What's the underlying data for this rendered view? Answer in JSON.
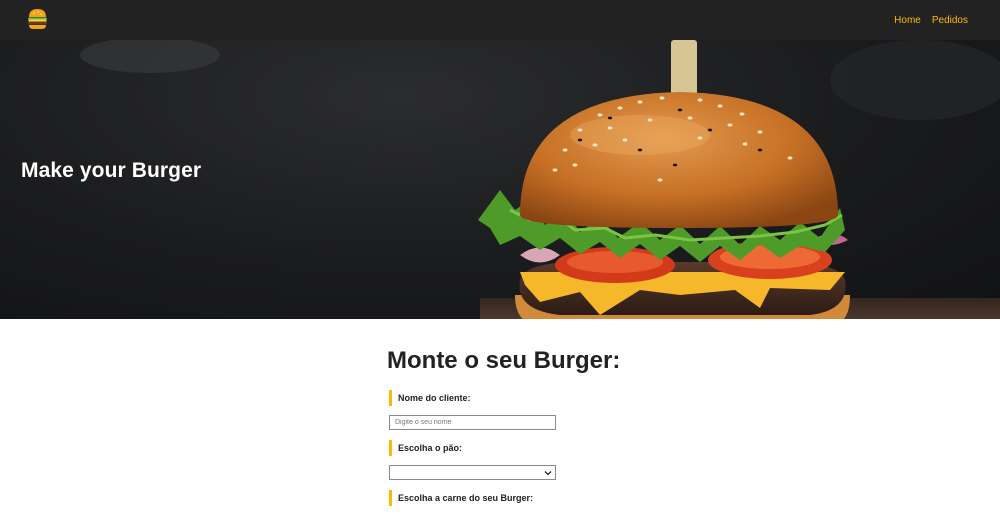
{
  "nav": {
    "logo_icon": "burger-icon",
    "links": [
      {
        "label": "Home"
      },
      {
        "label": "Pedidos"
      }
    ],
    "accent_color": "#fcba03",
    "background": "#222222"
  },
  "hero": {
    "title": "Make your Burger",
    "image": "burger-photo"
  },
  "form": {
    "title": "Monte o seu Burger:",
    "name_label": "Nome do cliente:",
    "name_placeholder": "Digite o seu nome",
    "bread_label": "Escolha o pão:",
    "bread_selected": "",
    "meat_label": "Escolha a carne do seu Burger:"
  }
}
